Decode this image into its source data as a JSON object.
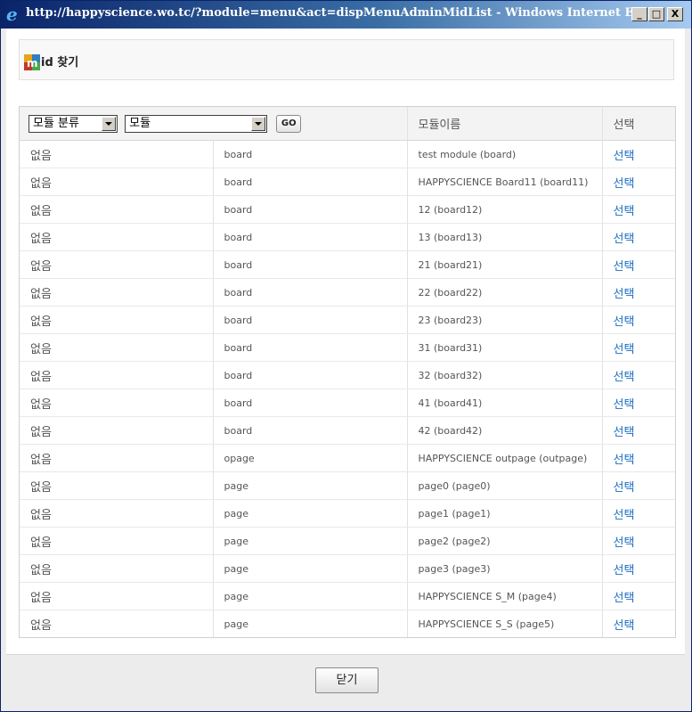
{
  "window": {
    "title": "http://happyscience.wo.tc/?module=menu&act=dispMenuAdminMidList - Windows Internet Ex...",
    "minimize": "_",
    "maximize": "□",
    "close": "X"
  },
  "header": {
    "title": "id 찾기"
  },
  "table": {
    "filter_category": "모듈 분류",
    "filter_module": "모듈",
    "go_label": "GO",
    "col_module_name": "모듈이름",
    "col_select": "선택",
    "rows": [
      {
        "category": "없음",
        "module": "board",
        "name": "test module (board)",
        "select": "선택"
      },
      {
        "category": "없음",
        "module": "board",
        "name": "HAPPYSCIENCE Board11 (board11)",
        "select": "선택"
      },
      {
        "category": "없음",
        "module": "board",
        "name": "12 (board12)",
        "select": "선택"
      },
      {
        "category": "없음",
        "module": "board",
        "name": "13 (board13)",
        "select": "선택"
      },
      {
        "category": "없음",
        "module": "board",
        "name": "21 (board21)",
        "select": "선택"
      },
      {
        "category": "없음",
        "module": "board",
        "name": "22 (board22)",
        "select": "선택"
      },
      {
        "category": "없음",
        "module": "board",
        "name": "23 (board23)",
        "select": "선택"
      },
      {
        "category": "없음",
        "module": "board",
        "name": "31 (board31)",
        "select": "선택"
      },
      {
        "category": "없음",
        "module": "board",
        "name": "32 (board32)",
        "select": "선택"
      },
      {
        "category": "없음",
        "module": "board",
        "name": "41 (board41)",
        "select": "선택"
      },
      {
        "category": "없음",
        "module": "board",
        "name": "42 (board42)",
        "select": "선택"
      },
      {
        "category": "없음",
        "module": "opage",
        "name": "HAPPYSCIENCE outpage (outpage)",
        "select": "선택"
      },
      {
        "category": "없음",
        "module": "page",
        "name": "page0 (page0)",
        "select": "선택"
      },
      {
        "category": "없음",
        "module": "page",
        "name": "page1 (page1)",
        "select": "선택"
      },
      {
        "category": "없음",
        "module": "page",
        "name": "page2 (page2)",
        "select": "선택"
      },
      {
        "category": "없음",
        "module": "page",
        "name": "page3 (page3)",
        "select": "선택"
      },
      {
        "category": "없음",
        "module": "page",
        "name": "HAPPYSCIENCE S_M (page4)",
        "select": "선택"
      },
      {
        "category": "없음",
        "module": "page",
        "name": "HAPPYSCIENCE S_S (page5)",
        "select": "선택"
      }
    ]
  },
  "footer": {
    "close_label": "닫기"
  }
}
